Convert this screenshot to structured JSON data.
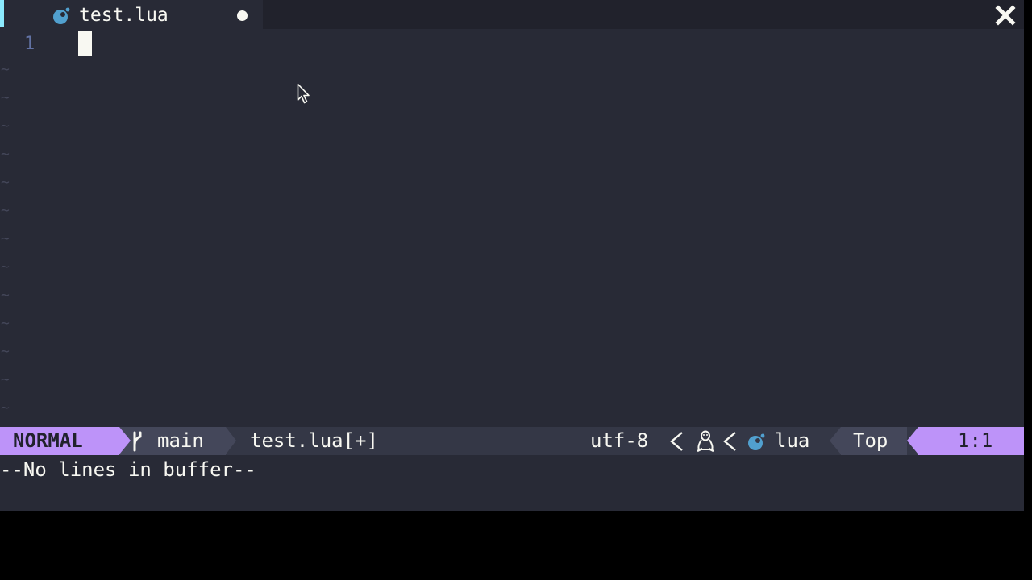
{
  "tabline": {
    "tab_title": "test.lua",
    "modified": true,
    "filetype_icon": "lua-icon",
    "close_icon": "close-icon"
  },
  "buffer": {
    "line_numbers": [
      "1"
    ],
    "empty_line_marker": "~"
  },
  "statusline": {
    "mode": "NORMAL",
    "branch": "main",
    "branch_icon": "git-branch-icon",
    "file": "test.lua[+]",
    "encoding": "utf-8",
    "os_icon": "linux-tux-icon",
    "filetype_icon": "lua-icon",
    "filetype": "lua",
    "position": "Top",
    "cursor": "1:1"
  },
  "cmdline": {
    "message": "--No lines in buffer--"
  },
  "colors": {
    "background": "#282a36",
    "accent_purple": "#bd93f9",
    "accent_cyan": "#8be9fd",
    "lua_blue": "#51a0cf"
  }
}
